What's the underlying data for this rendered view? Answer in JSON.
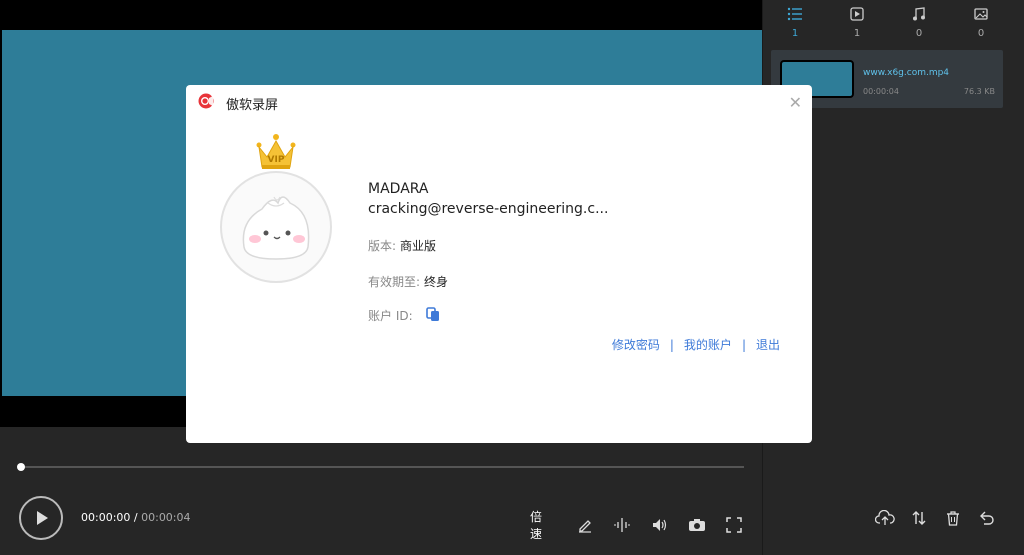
{
  "player": {
    "time_current": "00:00:00",
    "time_separator": " / ",
    "time_duration": "00:00:04",
    "progress": 0.0,
    "speed_label": "倍速"
  },
  "sidebar": {
    "tabs": [
      {
        "icon": "list-icon",
        "count": "1",
        "active": true
      },
      {
        "icon": "video-icon",
        "count": "1",
        "active": false
      },
      {
        "icon": "music-icon",
        "count": "0",
        "active": false
      },
      {
        "icon": "image-icon",
        "count": "0",
        "active": false
      }
    ],
    "file": {
      "name": "www.x6g.com.mp4",
      "duration": "00:00:04",
      "size": "76.3 KB"
    }
  },
  "modal": {
    "title": "傲软录屏",
    "username": "MADARA",
    "email": "cracking@reverse-engineering.c...",
    "version_label": "版本:",
    "version_value": "商业版",
    "expiry_label": "有效期至:",
    "expiry_value": "终身",
    "account_id_label": "账户 ID:",
    "badge": "VIP",
    "links": {
      "change_password": "修改密码",
      "my_account": "我的账户",
      "logout": "退出"
    }
  },
  "colors": {
    "accent": "#3da8d6",
    "video_bg": "#2e7d98",
    "link": "#3e7ad8"
  }
}
